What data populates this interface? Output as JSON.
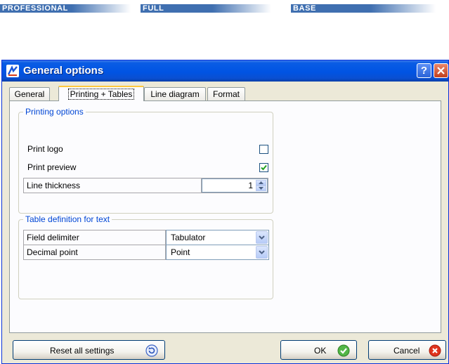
{
  "editions": {
    "professional": "PROFESSIONAL",
    "full": "FULL",
    "base": "BASE"
  },
  "window": {
    "title": "General options",
    "help_label": "?",
    "colors": {
      "titlebar": "#0054e3",
      "close": "#c23f1d",
      "group_title": "#0046d5"
    }
  },
  "tabs": [
    {
      "label": "General",
      "active": false
    },
    {
      "label": "Printing + Tables",
      "active": true
    },
    {
      "label": "Line diagram",
      "active": false
    },
    {
      "label": "Format",
      "active": false
    }
  ],
  "printing": {
    "group_title": "Printing options",
    "print_logo_label": "Print logo",
    "print_logo_checked": false,
    "print_preview_label": "Print preview",
    "print_preview_checked": true,
    "line_thickness_label": "Line thickness",
    "line_thickness_value": "1"
  },
  "table_def": {
    "group_title": "Table definition for text",
    "field_delimiter_label": "Field delimiter",
    "field_delimiter_value": "Tabulator",
    "decimal_point_label": "Decimal point",
    "decimal_point_value": "Point"
  },
  "buttons": {
    "reset_label": "Reset all settings",
    "ok_label": "OK",
    "cancel_label": "Cancel"
  }
}
